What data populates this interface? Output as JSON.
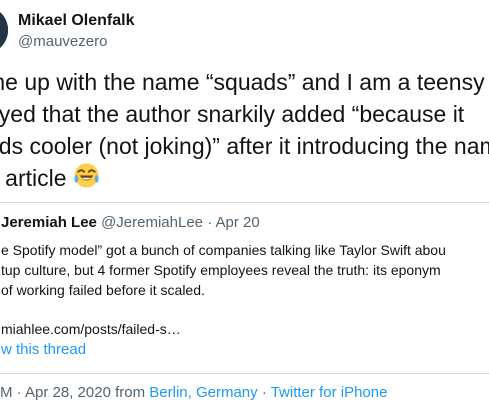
{
  "tweet": {
    "author": {
      "name": "Mikael Olenfalk",
      "handle": "@mauvezero"
    },
    "text_lines": [
      "me up with the name “squads” and I am a teensy b",
      "oyed that the author snarkily added “because it",
      "nds cooler (not joking)” after it introducing the nam",
      "e article"
    ],
    "emoji": "face-with-tears-of-joy"
  },
  "quoted_tweet": {
    "name": "Jeremiah Lee",
    "handle": "@JeremiahLee",
    "separator": "·",
    "date": "Apr 20",
    "body_lines": [
      "e Spotify model” got a bunch of companies talking like Taylor Swift abou",
      "tup culture, but 4 former Spotify employees reveal the truth: its eponym",
      "of working failed before it scaled."
    ],
    "link_text": "miahlee.com/posts/failed-s…",
    "thread_link": "w this thread"
  },
  "footer": {
    "time": "PM",
    "separator_1": "·",
    "date": "Apr 28, 2020",
    "from_label": "from",
    "location": "Berlin, Germany",
    "separator_2": "·",
    "client": "Twitter for iPhone"
  },
  "colors": {
    "text": "#0f1419",
    "secondary_text": "#536471",
    "link": "#1d9bf0",
    "border": "#cfd9de",
    "background": "#ffffff"
  }
}
